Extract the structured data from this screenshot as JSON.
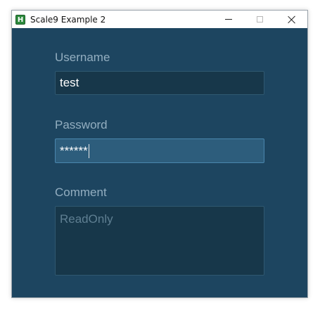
{
  "window": {
    "title": "Scale9 Example 2",
    "app_icon_letter": "H"
  },
  "form": {
    "username_label": "Username",
    "username_value": "test",
    "password_label": "Password",
    "password_value": "******",
    "comment_label": "Comment",
    "comment_value": "ReadOnly"
  },
  "colors": {
    "background": "#1d4560",
    "label": "#93aec0",
    "field": "#17374a",
    "field_focused": "#2d5d7c"
  }
}
